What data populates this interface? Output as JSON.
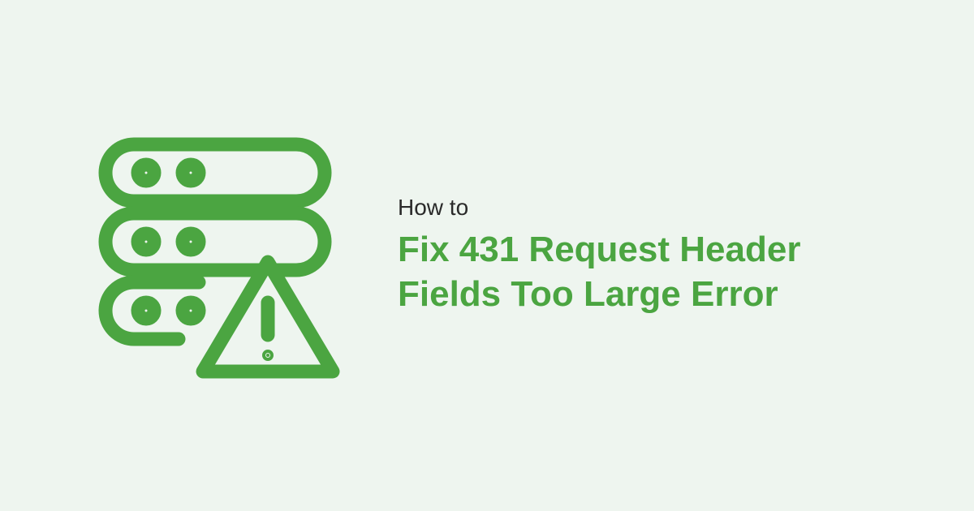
{
  "subtitle": "How to",
  "title": "Fix 431 Request Header Fields Too Large Error",
  "colors": {
    "background": "#eef5ef",
    "accent": "#4ba541",
    "text": "#2a2a2a"
  },
  "icon": "server-warning-icon"
}
